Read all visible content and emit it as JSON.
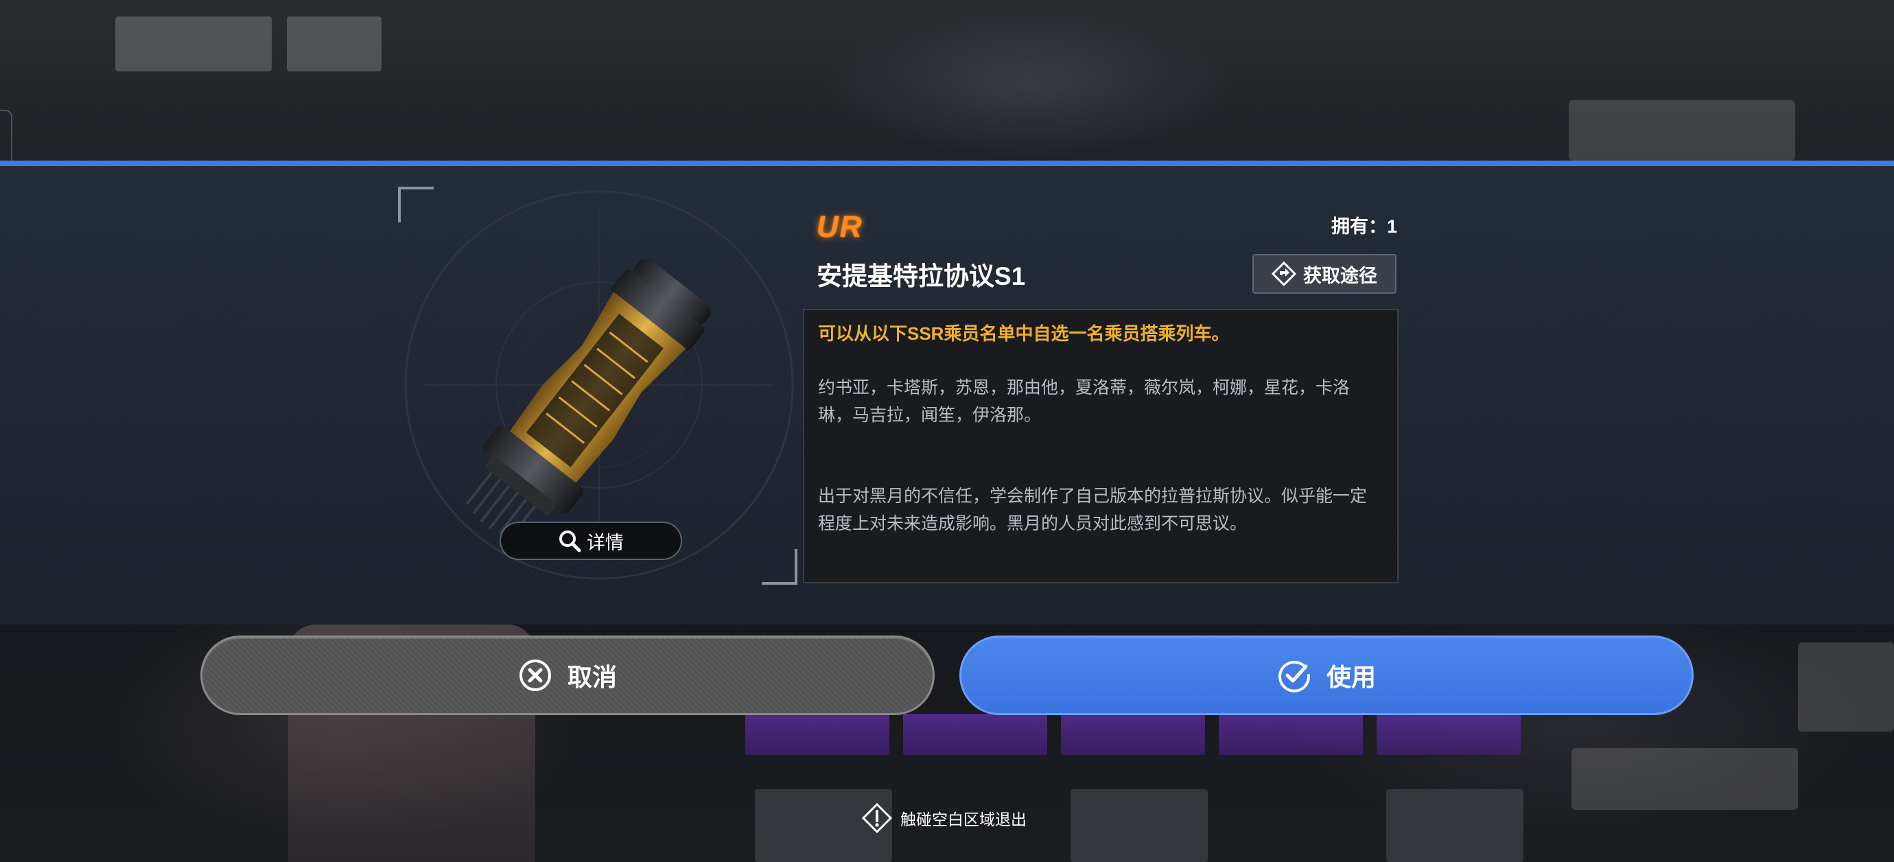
{
  "item": {
    "rarity": "UR",
    "name": "安提基特拉协议S1",
    "owned_label": "拥有：1",
    "image_icon": "capsule-item-icon"
  },
  "actions": {
    "details_label": "详情",
    "obtain_label": "获取途径",
    "cancel_label": "取消",
    "use_label": "使用"
  },
  "description": {
    "highlight": "可以从以下SSR乘员名单中自选一名乘员搭乘列车。",
    "crew_list": "约书亚，卡塔斯，苏恩，那由他，夏洛蒂，薇尔岚，柯娜，星花，卡洛琳，马吉拉，闻笙，伊洛那。",
    "flavor": "出于对黑月的不信任，学会制作了自己版本的拉普拉斯协议。似乎能一定程度上对未来造成影响。黑月的人员对此感到不可思议。"
  },
  "footer": {
    "exit_hint": "触碰空白区域退出"
  },
  "colors": {
    "accent_blue": "#3d7be0",
    "rarity_orange": "#ff8a1e",
    "highlight_gold": "#f0b02a"
  }
}
